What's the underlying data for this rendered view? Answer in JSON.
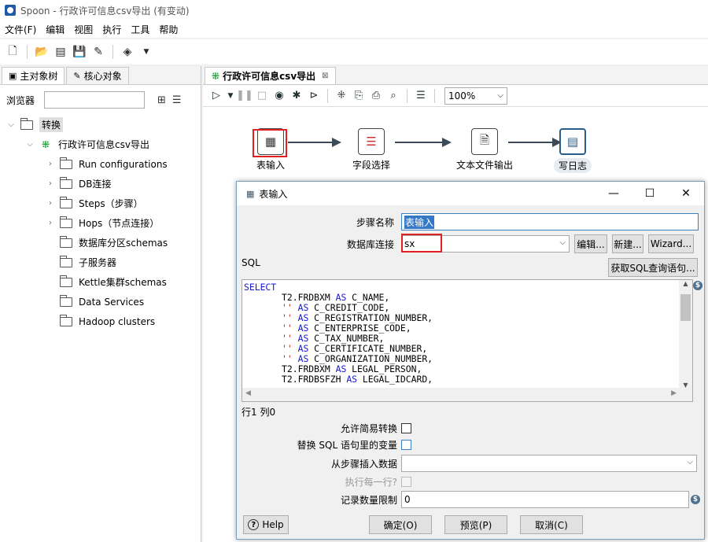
{
  "window": {
    "title": "Spoon - 行政许可信息csv导出 (有变动)"
  },
  "menu": [
    "文件(F)",
    "编辑",
    "视图",
    "执行",
    "工具",
    "帮助"
  ],
  "left": {
    "tabs": [
      "主对象树",
      "核心对象"
    ],
    "search_label": "浏览器",
    "root": "转换",
    "transform": "行政许可信息csv导出",
    "items": [
      "Run configurations",
      "DB连接",
      "Steps（步骤）",
      "Hops（节点连接）",
      "数据库分区schemas",
      "子服务器",
      "Kettle集群schemas",
      "Data Services",
      "Hadoop clusters"
    ]
  },
  "editor": {
    "tab": "行政许可信息csv导出",
    "zoom": "100%",
    "steps": [
      "表输入",
      "字段选择",
      "文本文件输出",
      "写日志"
    ]
  },
  "dialog": {
    "title": "表输入",
    "step_name_label": "步骤名称",
    "step_name_value": "表输入",
    "db_label": "数据库连接",
    "db_value": "sx",
    "edit_btn": "编辑...",
    "new_btn": "新建...",
    "wizard_btn": "Wizard...",
    "sql_label": "SQL",
    "get_sql_btn": "获取SQL查询语句...",
    "sql_lines": [
      {
        "kw": "SELECT",
        "rest": ""
      },
      {
        "ind": "       ",
        "lit": "",
        "expr": "T2.FRDBXM ",
        "as": "AS",
        "col": " C_NAME,"
      },
      {
        "ind": "       ",
        "lit": "'' ",
        "expr": "",
        "as": "AS",
        "col": " C_CREDIT_CODE,"
      },
      {
        "ind": "       ",
        "lit": "'' ",
        "expr": "",
        "as": "AS",
        "col": " C_REGISTRATION_NUMBER,"
      },
      {
        "ind": "       ",
        "lit": "'' ",
        "expr": "",
        "as": "AS",
        "col": " C_ENTERPRISE_CODE,"
      },
      {
        "ind": "       ",
        "lit": "'' ",
        "expr": "",
        "as": "AS",
        "col": " C_TAX_NUMBER,"
      },
      {
        "ind": "       ",
        "lit": "'' ",
        "expr": "",
        "as": "AS",
        "col": " C_CERTIFICATE_NUMBER,"
      },
      {
        "ind": "       ",
        "lit": "'' ",
        "expr": "",
        "as": "AS",
        "col": " C_ORGANIZATION_NUMBER,"
      },
      {
        "ind": "       ",
        "lit": "",
        "expr": "T2.FRDBXM ",
        "as": "AS",
        "col": " LEGAL_PERSON,"
      },
      {
        "ind": "       ",
        "lit": "",
        "expr": "T2.FRDBSFZH ",
        "as": "AS",
        "col": " LEGAL_IDCARD,"
      }
    ],
    "cursor_pos": "行1 列0",
    "lazy_label": "允许简易转换",
    "replace_vars_label": "替换 SQL 语句里的变量",
    "insert_from_label": "从步骤插入数据",
    "exec_each_label": "执行每一行?",
    "limit_label": "记录数量限制",
    "limit_value": "0",
    "help_btn": "Help",
    "ok_btn": "确定(O)",
    "preview_btn": "预览(P)",
    "cancel_btn": "取消(C)"
  },
  "colors": {
    "highlight_red": "#e0211f",
    "selection_blue": "#3478c6",
    "sql_keyword": "#1515d0",
    "sql_string": "#c12020"
  }
}
